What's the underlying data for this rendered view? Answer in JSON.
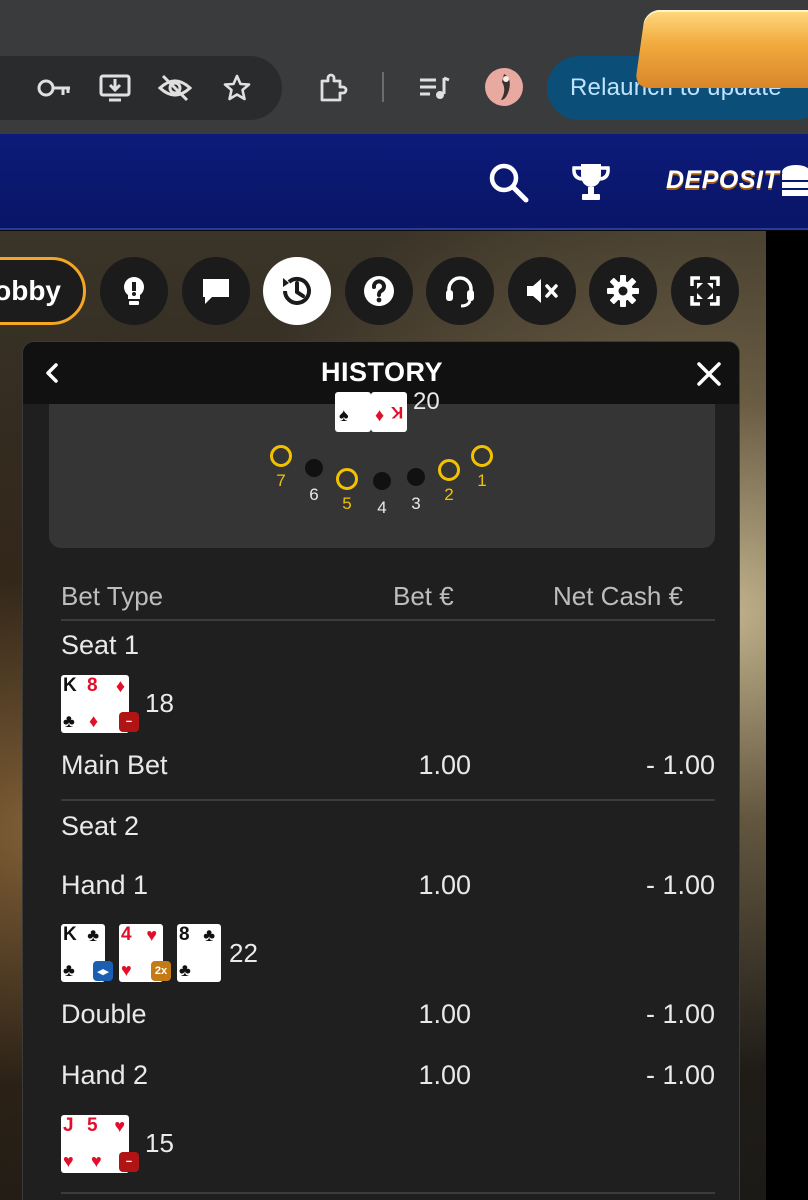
{
  "browser": {
    "relaunch_label": "Relaunch to update",
    "toolbar_icons": [
      "key-icon",
      "install-app-icon",
      "eye-off-icon",
      "star-icon",
      "extensions-icon",
      "media-queue-icon"
    ]
  },
  "site_header": {
    "deposit_label": "DEPOSIT",
    "icons": [
      "search-icon",
      "trophy-icon"
    ]
  },
  "game_toolbar": {
    "lobby_label": "obby",
    "buttons": [
      "hint-icon",
      "chat-icon",
      "history-icon",
      "help-icon",
      "support-icon",
      "mute-icon",
      "settings-icon",
      "fullscreen-icon"
    ],
    "active_button": "history-icon"
  },
  "history": {
    "title": "HISTORY",
    "dealer": {
      "total": "20",
      "seats": [
        {
          "number": "7",
          "bet": true
        },
        {
          "number": "6",
          "bet": false
        },
        {
          "number": "5",
          "bet": true
        },
        {
          "number": "4",
          "bet": false
        },
        {
          "number": "3",
          "bet": false
        },
        {
          "number": "2",
          "bet": true
        },
        {
          "number": "1",
          "bet": true
        }
      ]
    },
    "columns": {
      "bet_type": "Bet Type",
      "bet": "Bet €",
      "net_cash": "Net Cash €"
    },
    "seat1": {
      "label": "Seat 1",
      "hand_total": "18",
      "rows": [
        {
          "type": "Main Bet",
          "bet": "1.00",
          "net": "- 1.00"
        }
      ]
    },
    "seat2": {
      "label": "Seat 2",
      "hand1": {
        "type": "Hand 1",
        "bet": "1.00",
        "net": "- 1.00",
        "total": "22"
      },
      "double": {
        "type": "Double",
        "bet": "1.00",
        "net": "- 1.00"
      },
      "hand2": {
        "type": "Hand 2",
        "bet": "1.00",
        "net": "- 1.00",
        "total": "15"
      }
    },
    "cards": {
      "dealer": [
        {
          "rank": "",
          "suit": "♠",
          "color": "black"
        },
        {
          "rank": "K",
          "suit": "♦",
          "color": "red"
        }
      ],
      "seat1": [
        {
          "rank": "K",
          "suit": "♣",
          "color": "black"
        },
        {
          "rank": "8",
          "suit": "♦",
          "color": "red"
        }
      ],
      "seat2_hand1": [
        {
          "rank": "K",
          "suit": "♣",
          "color": "black"
        },
        {
          "rank": "4",
          "suit": "♥",
          "color": "red"
        },
        {
          "rank": "8",
          "suit": "♣",
          "color": "black"
        }
      ],
      "seat2_hand2": [
        {
          "rank": "J",
          "suit": "♥",
          "color": "red"
        },
        {
          "rank": "5",
          "suit": "♥",
          "color": "red"
        }
      ]
    },
    "badges": {
      "lose": "−",
      "split": "◂▸",
      "double": "2x"
    }
  },
  "colors": {
    "header_blue": "#0c1b7a",
    "relaunch_bg": "#0b4f78",
    "gold": "#f2c200",
    "panel_bg": "#1f1f1f",
    "lobby_border": "#f5a623"
  }
}
